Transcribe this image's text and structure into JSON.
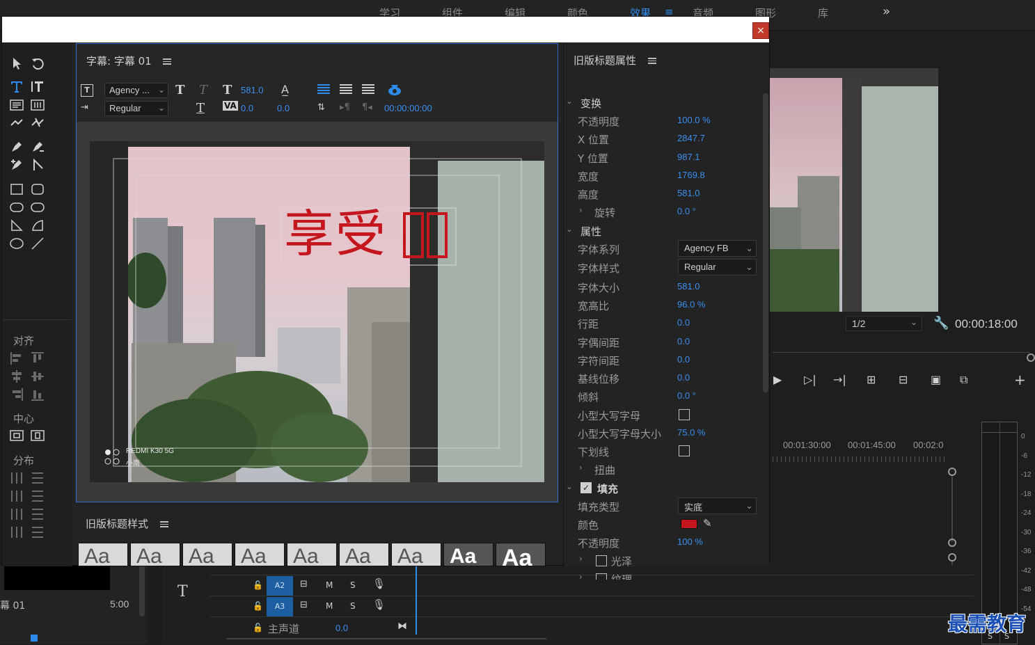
{
  "workspace_tabs": [
    "学习",
    "组件",
    "编辑",
    "颜色",
    "效果",
    "≡",
    "音频",
    "图形",
    "库"
  ],
  "active_tab": "效果",
  "more_tabs": "»",
  "dialog": {
    "close": "×",
    "titler": {
      "header": "字幕: 字幕 01",
      "font_family": "Agency ...",
      "font_style": "Regular",
      "font_size": "581.0",
      "kerning": "0.0",
      "leading": "0.0",
      "timecode": "00:00:00:00",
      "canvas_title": "享受",
      "camera_watermark_1": "REDMI K30 5G",
      "camera_watermark_2": "小南"
    },
    "styles": {
      "header": "旧版标题样式",
      "swatches": [
        "Aa",
        "Aa",
        "Aa",
        "Aa",
        "Aa",
        "Aa",
        "Aa",
        "Aa",
        "Aa"
      ]
    },
    "tools": {
      "align_label": "对齐",
      "center_label": "中心",
      "distribute_label": "分布"
    },
    "properties": {
      "header": "旧版标题属性",
      "transform": {
        "label": "变换",
        "opacity_label": "不透明度",
        "opacity": "100.0 %",
        "x_label": "X 位置",
        "x": "2847.7",
        "y_label": "Y 位置",
        "y": "987.1",
        "width_label": "宽度",
        "width": "1769.8",
        "height_label": "高度",
        "height": "581.0",
        "rotation_label": "旋转",
        "rotation": "0.0 °"
      },
      "attributes": {
        "label": "属性",
        "font_family_label": "字体系列",
        "font_family": "Agency FB",
        "font_style_label": "字体样式",
        "font_style": "Regular",
        "font_size_label": "字体大小",
        "font_size": "581.0",
        "aspect_label": "宽高比",
        "aspect": "96.0 %",
        "leading_label": "行距",
        "leading": "0.0",
        "kerning_label": "字偶间距",
        "kerning": "0.0",
        "tracking_label": "字符间距",
        "tracking": "0.0",
        "baseline_label": "基线位移",
        "baseline": "0.0",
        "slant_label": "倾斜",
        "slant": "0.0 °",
        "smallcaps_label": "小型大写字母",
        "smallcaps_size_label": "小型大写字母大小",
        "smallcaps_size": "75.0 %",
        "underline_label": "下划线",
        "distort_label": "扭曲"
      },
      "fill": {
        "label": "填充",
        "type_label": "填充类型",
        "type": "实底",
        "color_label": "颜色",
        "color": "#c4161c",
        "opacity_label": "不透明度",
        "opacity": "100 %",
        "sheen_label": "光泽",
        "texture_label": "纹理"
      }
    }
  },
  "program_monitor": {
    "resolution": "1/2",
    "timecode": "00:00:18:00"
  },
  "timeline": {
    "ruler": [
      "00:01:30:00",
      "00:01:45:00",
      "00:02:0"
    ],
    "tracks": [
      {
        "name": "A2",
        "m": "M",
        "s": "S"
      },
      {
        "name": "A3",
        "m": "M",
        "s": "S"
      }
    ],
    "master_label": "主声道",
    "master_value": "0.0",
    "meter_ticks": [
      "0",
      "-6",
      "-12",
      "-18",
      "-24",
      "-30",
      "-36",
      "-42",
      "-48",
      "-54"
    ],
    "meter_bottom": [
      "S",
      "S"
    ]
  },
  "project_panel": {
    "clip_name": "幕 01",
    "clip_duration": "5:00"
  },
  "watermark": "最需教育"
}
